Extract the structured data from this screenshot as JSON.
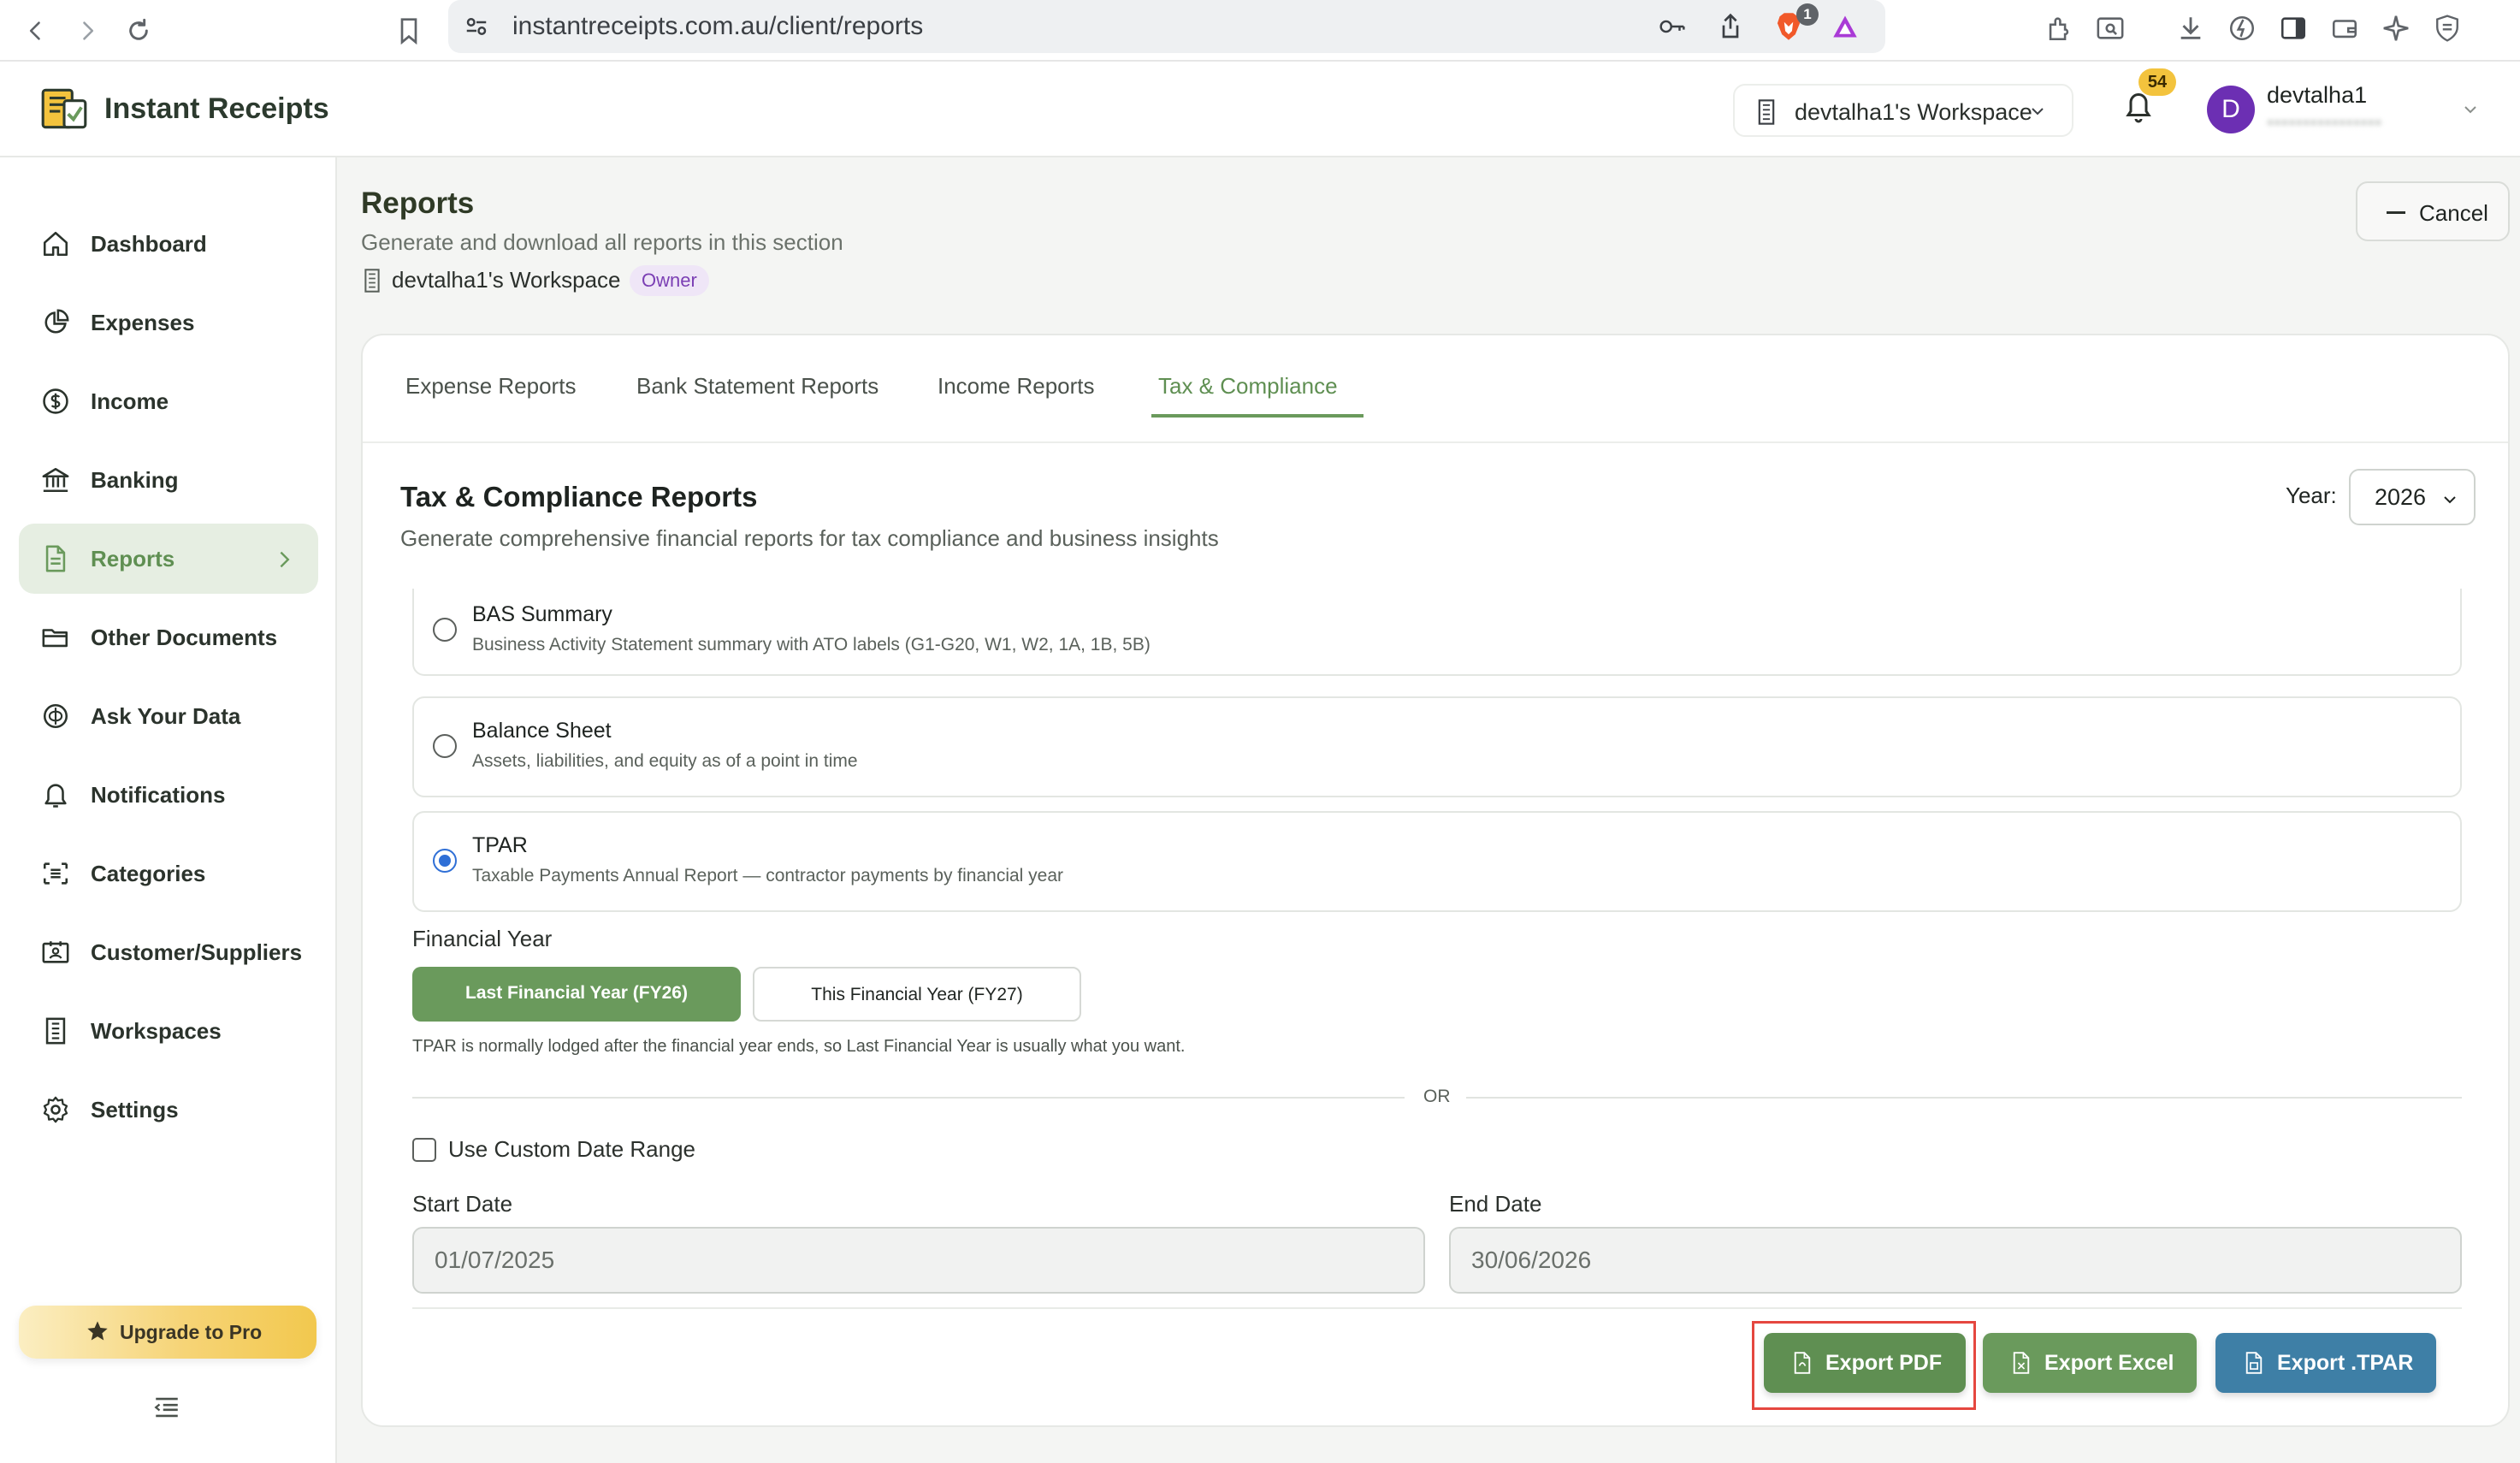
{
  "browser": {
    "url": "instantreceipts.com.au/client/reports",
    "extension_badge": "1"
  },
  "app": {
    "name": "Instant Receipts",
    "workspace_selector": "devtalha1's Workspace",
    "notification_count": "54",
    "user": {
      "initial": "D",
      "name": "devtalha1",
      "email_obscured": "••••••••••••••••"
    }
  },
  "sidebar": {
    "items": [
      {
        "label": "Dashboard",
        "icon": "home-icon"
      },
      {
        "label": "Expenses",
        "icon": "pie-chart-icon"
      },
      {
        "label": "Income",
        "icon": "dollar-circle-icon"
      },
      {
        "label": "Banking",
        "icon": "bank-icon"
      },
      {
        "label": "Reports",
        "icon": "document-icon",
        "active": true
      },
      {
        "label": "Other Documents",
        "icon": "folder-icon"
      },
      {
        "label": "Ask Your Data",
        "icon": "ai-spark-icon"
      },
      {
        "label": "Notifications",
        "icon": "bell-icon"
      },
      {
        "label": "Categories",
        "icon": "list-icon"
      },
      {
        "label": "Customer/Suppliers",
        "icon": "contact-card-icon"
      },
      {
        "label": "Workspaces",
        "icon": "building-icon"
      },
      {
        "label": "Settings",
        "icon": "gear-icon"
      }
    ],
    "upgrade_label": "Upgrade to Pro"
  },
  "page": {
    "title": "Reports",
    "subtitle": "Generate and download all reports in this section",
    "workspace": "devtalha1's Workspace",
    "role_badge": "Owner",
    "cancel_label": "Cancel"
  },
  "tabs": [
    {
      "label": "Expense Reports"
    },
    {
      "label": "Bank Statement Reports"
    },
    {
      "label": "Income Reports"
    },
    {
      "label": "Tax & Compliance",
      "active": true
    }
  ],
  "section": {
    "title": "Tax & Compliance Reports",
    "subtitle": "Generate comprehensive financial reports for tax compliance and business insights",
    "year_label": "Year:",
    "year_value": "2026"
  },
  "report_options": [
    {
      "name": "BAS Summary",
      "description": "Business Activity Statement summary with ATO labels (G1-G20, W1, W2, 1A, 1B, 5B)",
      "selected": false
    },
    {
      "name": "Balance Sheet",
      "description": "Assets, liabilities, and equity as of a point in time",
      "selected": false
    },
    {
      "name": "TPAR",
      "description": "Taxable Payments Annual Report — contractor payments by financial year",
      "selected": true
    }
  ],
  "financial_year": {
    "label": "Financial Year",
    "last_fy": "Last Financial Year (FY26)",
    "this_fy": "This Financial Year (FY27)",
    "note": "TPAR is normally lodged after the financial year ends, so Last Financial Year is usually what you want."
  },
  "or_text": "OR",
  "custom_range": {
    "label": "Use Custom Date Range",
    "checked": false
  },
  "dates": {
    "start_label": "Start Date",
    "start_value": "01/07/2025",
    "end_label": "End Date",
    "end_value": "30/06/2026"
  },
  "exports": {
    "pdf": "Export PDF",
    "excel": "Export Excel",
    "tpar": "Export .TPAR"
  },
  "colors": {
    "accent_green": "#6a9a5c",
    "export_blue": "#3e7fa6",
    "owner_purple": "#7b3fb4",
    "highlight_red": "#e5473f"
  }
}
